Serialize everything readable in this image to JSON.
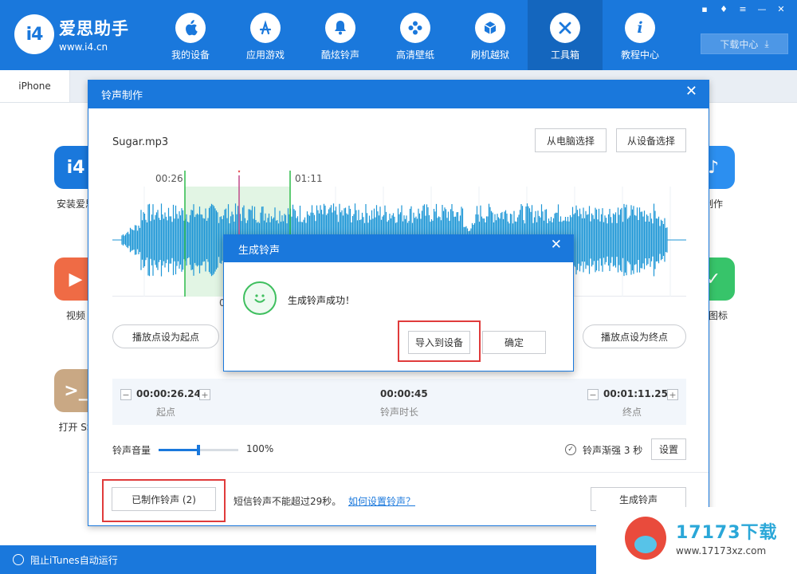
{
  "app": {
    "name": "爱思助手",
    "url": "www.i4.cn",
    "logo_mark": "i4"
  },
  "nav": [
    {
      "label": "我的设备",
      "icon": "apple-icon",
      "glyph": ""
    },
    {
      "label": "应用游戏",
      "icon": "app-store-icon",
      "glyph": "A"
    },
    {
      "label": "酷炫铃声",
      "icon": "bell-icon",
      "glyph": "♪"
    },
    {
      "label": "高清壁纸",
      "icon": "flower-icon",
      "glyph": "✿"
    },
    {
      "label": "刷机越狱",
      "icon": "box-icon",
      "glyph": "⬡"
    },
    {
      "label": "工具箱",
      "icon": "tools-icon",
      "glyph": "✕",
      "active": true
    },
    {
      "label": "教程中心",
      "icon": "info-icon",
      "glyph": "i"
    }
  ],
  "download_center": "下载中心",
  "device_tab": "iPhone",
  "tools": [
    {
      "label": "安装爱思",
      "color": "#1a78dc",
      "glyph": "i4"
    },
    {
      "label": "视频",
      "color": "#ef6b45",
      "glyph": "▶"
    },
    {
      "label": "打开 SS",
      "color": "#c9a884",
      "glyph": ">_"
    }
  ],
  "tools_right": [
    {
      "label": "制作",
      "color": "#2c8ff0",
      "glyph": "♪"
    },
    {
      "label": "废图标",
      "color": "#37c46a",
      "glyph": "✓"
    }
  ],
  "status": {
    "itunes_block": "阻止iTunes自动运行"
  },
  "ringtone_dialog": {
    "title": "铃声制作",
    "file_name": "Sugar.mp3",
    "pick_from_pc": "从电脑选择",
    "pick_from_device": "从设备选择",
    "time_mark_start": "00:26",
    "time_mark_end": "01:11",
    "time_mark_playhead": "0",
    "set_start_btn": "播放点设为起点",
    "set_end_btn": "播放点设为终点",
    "start_value": "00:00:26.248",
    "start_caption": "起点",
    "duration_value": "00:00:45",
    "duration_caption": "铃声时长",
    "end_value": "00:01:11.251",
    "end_caption": "终点",
    "volume_label": "铃声音量",
    "volume_pct": "100%",
    "volume_level": 0.5,
    "fade_label": "铃声渐强 3 秒",
    "settings_btn": "设置",
    "made_ringtones_btn": "已制作铃声 (2)",
    "sms_tip": "短信铃声不能超过29秒。",
    "howto_link": "如何设置铃声？",
    "generate_btn": "生成铃声",
    "accent_color": "#1a78dc",
    "selection_color": "#2dbb4a",
    "playhead_color": "#e53939"
  },
  "success_dialog": {
    "title": "生成铃声",
    "message": "生成铃声成功！",
    "import_btn": "导入到设备",
    "ok_btn": "确定"
  },
  "watermark": {
    "name": "17173下载",
    "url": "www.17173xz.com"
  }
}
